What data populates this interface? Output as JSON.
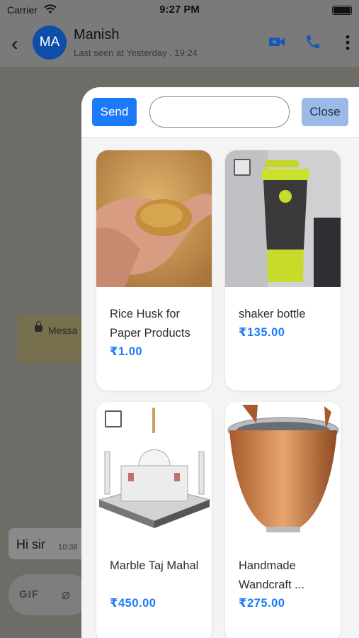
{
  "status_bar": {
    "carrier": "Carrier",
    "time": "9:27 PM"
  },
  "header": {
    "avatar_initials": "MA",
    "contact_name": "Manish",
    "last_seen": "Last seen at Yesterday , 19:24",
    "icons": [
      "back-chevron-icon",
      "video-call-icon",
      "phone-icon",
      "more-vert-icon"
    ],
    "accent_color": "#1a7af8"
  },
  "chat": {
    "locked_message_preview": "Messa",
    "message_text": "Hi sir",
    "message_time": "10:38",
    "composer_gif_label": "GIF"
  },
  "product_sheet": {
    "send_label": "Send",
    "search_value": "",
    "close_label": "Close",
    "products": [
      {
        "name": "Rice Husk for Paper Products",
        "price": "₹1.00",
        "image": "rice-husk-photo",
        "checkbox": false
      },
      {
        "name": "shaker bottle",
        "price": "₹135.00",
        "image": "shaker-bottle-photo",
        "checkbox": true
      },
      {
        "name": "Marble Taj Mahal",
        "price": "₹450.00",
        "image": "marble-taj-mahal-photo",
        "checkbox": true
      },
      {
        "name": "Handmade Wandcraft ...",
        "price": "₹275.00",
        "image": "copper-bucket-photo",
        "checkbox": false
      }
    ]
  }
}
